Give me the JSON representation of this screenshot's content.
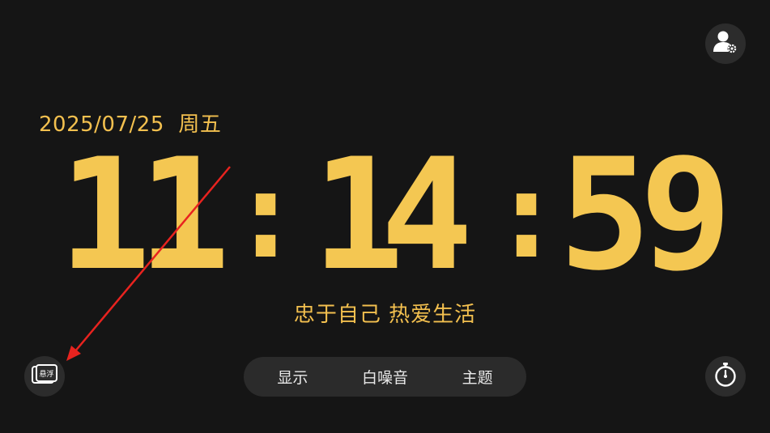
{
  "header": {
    "date": "2025/07/25",
    "weekday": "周五"
  },
  "clock": {
    "hour_1": "1",
    "hour_2": "1",
    "minute_1": "1",
    "minute_2": "4",
    "second_1": "5",
    "second_2": "9",
    "separator": ":"
  },
  "slogan": "忠于自己 热爱生活",
  "bottom_bar": {
    "tabs": [
      {
        "label": "显示"
      },
      {
        "label": "白噪音"
      },
      {
        "label": "主题"
      }
    ]
  },
  "buttons": {
    "user_settings_icon": "user-settings-icon",
    "float_icon": "floating-window-icon",
    "float_icon_text": "悬浮",
    "timer_icon": "stopwatch-icon"
  },
  "colors": {
    "accent": "#f4c752",
    "background": "#151515",
    "button_bg": "#2c2c2c",
    "annotation_arrow": "#e8231f"
  }
}
